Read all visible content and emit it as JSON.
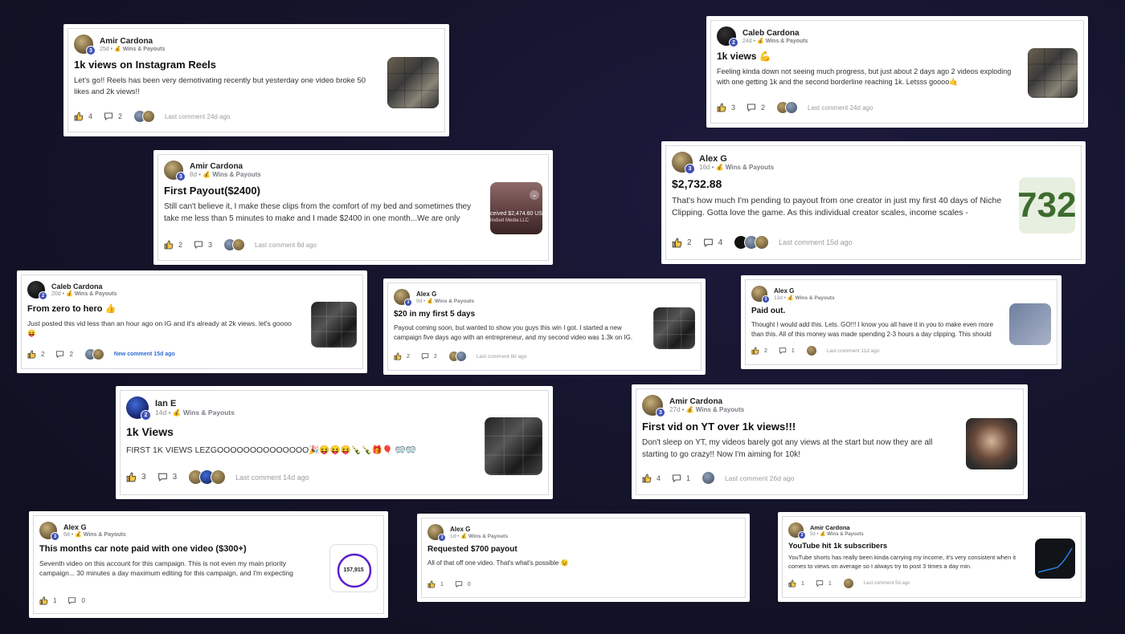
{
  "cat": "💰 Wins & Payouts",
  "cards": {
    "c1": {
      "author": "Amir Cardona",
      "level": "3",
      "age": "25d",
      "title": "1k views on Instagram Reels",
      "body": "Let's go!! Reels has been very demotivating recently but yesterday one video broke 50 likes and 2k views!!",
      "likes": "4",
      "comments": "2",
      "last": "Last comment 24d ago"
    },
    "c2": {
      "author": "Caleb Cardona",
      "level": "2",
      "age": "24d",
      "title": "1k views 💪",
      "body": "Feeling kinda down not seeing much progress, but just about 2 days ago 2 videos exploding with one getting 1k and the second borderline reaching 1k. Letsss goooo🤙",
      "likes": "3",
      "comments": "2",
      "last": "Last comment 24d ago"
    },
    "c3": {
      "author": "Amir Cardona",
      "level": "3",
      "age": "8d",
      "title": "First Payout($2400)",
      "body": "Still can't believe it, I make these clips from the comfort of my bed and sometimes they take me less than 5 minutes to make and I made $2400 in one month...We are only",
      "likes": "2",
      "comments": "3",
      "last": "Last comment 8d ago",
      "thumb_text": "ceived $2,474.60 US",
      "thumb_text2": "lindset Media LLC"
    },
    "c4": {
      "author": "Alex G",
      "level": "3",
      "age": "16d",
      "title": "$2,732.88",
      "body": "That's how much I'm pending to payout from one creator in just my first 40 days of Niche Clipping. Gotta love the game. As this individual creator scales, income scales -",
      "likes": "2",
      "comments": "4",
      "last": "Last comment 15d ago",
      "thumb_text": "732"
    },
    "c5": {
      "author": "Caleb Cardona",
      "level": "2",
      "age": "20d",
      "title": "From zero to hero 👍",
      "body": "Just posted this vid less than an hour ago on IG and it's already at 2k views. let's goooo😝",
      "likes": "2",
      "comments": "2",
      "last": "New comment 15d ago"
    },
    "c6": {
      "author": "Alex G",
      "level": "3",
      "age": "9d",
      "title": "$20 in my first 5 days",
      "body": "Payout coming soon, but wanted to show you guys this win I got. I started a new campaign five days ago with an entrepreneur, and my second video was 1.3k on IG.",
      "likes": "2",
      "comments": "2",
      "last": "Last comment 8d ago"
    },
    "c7": {
      "author": "Alex G",
      "level": "3",
      "age": "13d",
      "title": "Paid out.",
      "body": "Thought I would add this. Lets. GO!!! I know you all have it in you to make even more than this. All of this money was made spending 2-3 hours a day clipping. This should",
      "likes": "2",
      "comments": "1",
      "last": "Last comment 11d ago"
    },
    "c8": {
      "author": "Ian E",
      "level": "2",
      "age": "14d",
      "title": "1k Views",
      "body": "FIRST 1K VIEWS LEZGOOOOOOOOOOOOOO🎉😝😝😝🍾🍾🎁🎈 🥽🥽",
      "likes": "3",
      "comments": "3",
      "last": "Last comment 14d ago"
    },
    "c9": {
      "author": "Amir Cardona",
      "level": "3",
      "age": "27d",
      "title": "First vid on YT over 1k views!!!",
      "body": "Don't sleep on YT, my videos barely got any views at the start but now they are all starting to go crazy!! Now I'm aiming for 10k!",
      "likes": "4",
      "comments": "1",
      "last": "Last comment 26d ago"
    },
    "c10": {
      "author": "Alex G",
      "level": "3",
      "age": "6d",
      "title": "This months car note paid with one video ($300+)",
      "body": "Seventh video on this account for this campaign. This is not even my main priority campaign... 30 minutes a day maximum editing for this campaign, and I'm expecting",
      "likes": "1",
      "comments": "0",
      "last": "",
      "thumb_text": "157,915"
    },
    "c11": {
      "author": "Alex G",
      "level": "3",
      "age": "1d",
      "title": "Requested $700 payout",
      "body": "All of that off one video. That's what's possible 😉",
      "likes": "1",
      "comments": "0",
      "last": ""
    },
    "c12": {
      "author": "Amir Cardona",
      "level": "3",
      "age": "5d",
      "title": "YouTube hit 1k subscribers",
      "body": "YouTube shorts has really been kinda carrying my income, it's very consistent when it comes to views on average so I always try to post 3 times a day min.",
      "likes": "1",
      "comments": "1",
      "last": "Last comment 5d ago"
    }
  }
}
